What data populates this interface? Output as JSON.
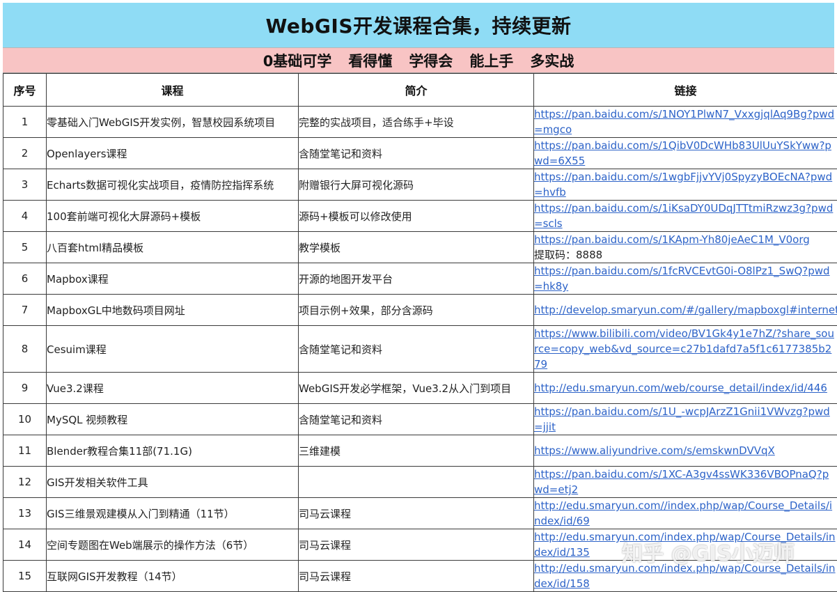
{
  "title": "WebGIS开发课程合集，持续更新",
  "subtitle": [
    "0基础可学",
    "看得懂",
    "学得会",
    "能上手",
    "多实战"
  ],
  "headers": {
    "num": "序号",
    "course": "课程",
    "intro": "简介",
    "link": "链接"
  },
  "rows": [
    {
      "num": "1",
      "course": "零基础入门WebGIS开发实例，智慧校园系统项目",
      "intro": "完整的实战项目，适合练手+毕设",
      "link": "https://pan.baidu.com/s/1NOY1PlwN7_VxxgjqlAq9Bg?pwd=mgco",
      "extra": ""
    },
    {
      "num": "2",
      "course": "Openlayers课程",
      "intro": "含随堂笔记和资料",
      "link": "https://pan.baidu.com/s/1QibV0DcWHb83UlUuYSkYww?pwd=6X55",
      "extra": ""
    },
    {
      "num": "3",
      "course": "Echarts数据可视化实战项目，疫情防控指挥系统",
      "intro": "附赠银行大屏可视化源码",
      "link": "https://pan.baidu.com/s/1wgbFjjvYVj0SpyzyBOEcNA?pwd=hvfb",
      "extra": ""
    },
    {
      "num": "4",
      "course": "100套前端可视化大屏源码+模板",
      "intro": "源码+模板可以修改使用",
      "link": "https://pan.baidu.com/s/1iKsaDY0UDqJTTtmiRzwz3g?pwd=scls",
      "extra": ""
    },
    {
      "num": "5",
      "course": "八百套html精品模板",
      "intro": "教学模板",
      "link": "https://pan.baidu.com/s/1KApm-Yh80jeAeC1M_V0org",
      "extra": "提取码：8888"
    },
    {
      "num": "6",
      "course": "Mapbox课程",
      "intro": "开源的地图开发平台",
      "link": "https://pan.baidu.com/s/1fcRVCEvtG0i-O8lPz1_SwQ?pwd=hk8y",
      "extra": ""
    },
    {
      "num": "7",
      "course": "MapboxGL中地数码项目网址",
      "intro": "项目示例+效果，部分含源码",
      "link": "http://develop.smaryun.com/#/gallery/mapboxgl#internet#inte",
      "extra": ""
    },
    {
      "num": "8",
      "course": "Cesuim课程",
      "intro": "含随堂笔记和资料",
      "link": "https://www.bilibili.com/video/BV1Gk4y1e7hZ/?share_source=copy_web&vd_source=c27b1dafd7a5f1c6177385b279",
      "extra": ""
    },
    {
      "num": "9",
      "course": "Vue3.2课程",
      "intro": "WebGIS开发必学框架，Vue3.2从入门到项目",
      "link": "http://edu.smaryun.com/web/course_detail/index/id/446",
      "extra": ""
    },
    {
      "num": "10",
      "course": "MySQL 视频教程",
      "intro": "含随堂笔记和资料",
      "link": "https://pan.baidu.com/s/1U_-wcpJArzZ1Gnii1VWvzg?pwd=jjit",
      "extra": ""
    },
    {
      "num": "11",
      "course": "Blender教程合集11部(71.1G)",
      "intro": "三维建模",
      "link": "https://www.aliyundrive.com/s/emskwnDVVqX",
      "extra": ""
    },
    {
      "num": "12",
      "course": "GIS开发相关软件工具",
      "intro": "",
      "link": "https://pan.baidu.com/s/1XC-A3gv4ssWK336VBOPnaQ?pwd=etj2",
      "extra": ""
    },
    {
      "num": "13",
      "course": "GIS三维景观建模从入门到精通（11节）",
      "intro": "司马云课程",
      "link": "http://edu.smaryun.com//index.php/wap/Course_Details/index/id/69",
      "extra": ""
    },
    {
      "num": "14",
      "course": "空间专题图在Web端展示的操作方法（6节）",
      "intro": "司马云课程",
      "link": "http://edu.smaryun.com/index.php/wap/Course_Details/index/id/135",
      "extra": ""
    },
    {
      "num": "15",
      "course": "互联网GIS开发教程（14节）",
      "intro": "司马云课程",
      "link": "http://edu.smaryun.com/index.php/wap/Course_Details/index/id/158",
      "extra": ""
    }
  ],
  "watermark": "知乎 @GIS小迈师",
  "colors": {
    "title_bg": "#8fdcf5",
    "subtitle_bg": "#f8c4c4",
    "link": "#2d63c8"
  }
}
